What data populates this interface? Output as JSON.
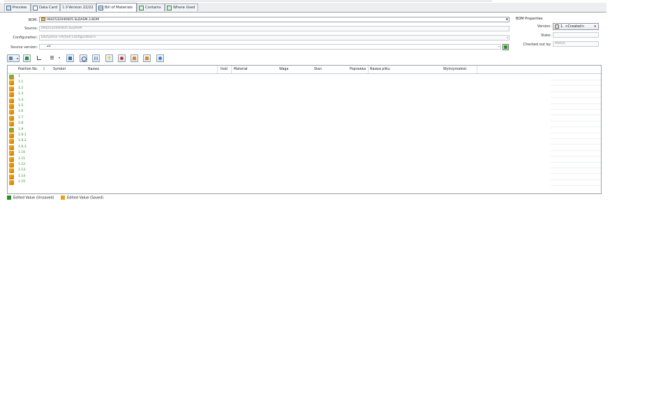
{
  "tabs": [
    {
      "label": "Preview",
      "icon": "preview-icon"
    },
    {
      "label": "Data Card",
      "icon": "data-card-icon"
    },
    {
      "label": "Version 22/22",
      "icon": "version-icon"
    },
    {
      "label": "Bill of Materials",
      "icon": "bom-icon",
      "active": true
    },
    {
      "label": "Contains",
      "icon": "contains-icon"
    },
    {
      "label": "Where Used",
      "icon": "where-used-icon"
    }
  ],
  "form": {
    "bom_label": "BOM:",
    "bom_value": "0642532040605.SLDASM.3.BOM",
    "source_label": "Source:",
    "source_value": "0642532040605.SLDASM",
    "configuration_label": "Configuration:",
    "configuration_value": "Domyślna <Active Configuration>",
    "source_version_label": "Source version:",
    "source_version_value": "22"
  },
  "bom_properties": {
    "title": "BOM Properties",
    "version_label": "Version:",
    "version_value": "1. <Created>",
    "state_label": "State:",
    "state_value": "",
    "checked_out_label": "Checked out by:",
    "checked_out_value": "Admin"
  },
  "toolbar": {
    "buttons": [
      "export-icon",
      "excel-icon",
      "tree-view-icon",
      "indent-icon",
      "table-view-icon",
      "find-icon",
      "columns-icon",
      "filter-icon",
      "target-icon",
      "previous-icon",
      "next-icon",
      "help-icon"
    ]
  },
  "grid": {
    "columns": [
      "Position No.",
      "Symbol",
      "Nazwa",
      "Ilość",
      "Materiał",
      "Waga",
      "Stan",
      "Poprawka",
      "Nazwa pliku",
      "Wytrzymałość"
    ],
    "sort_indicator": "↕",
    "rows": [
      "1",
      "1.1",
      "1.2",
      "1.3",
      "1.4",
      "1.5",
      "1.6",
      "1.7",
      "1.8",
      "1.9",
      "1.9.1",
      "1.9.2",
      "1.9.3",
      "1.10",
      "1.11",
      "1.12",
      "1.13",
      "1.14",
      "1.15"
    ]
  },
  "legend": {
    "unsaved": "Edited Value (Unsaved)",
    "saved": "Edited Value (Saved)"
  },
  "colors": {
    "unsaved": "#2e8b1e",
    "saved": "#e8a21a",
    "position_text": "#2a8a2a"
  }
}
